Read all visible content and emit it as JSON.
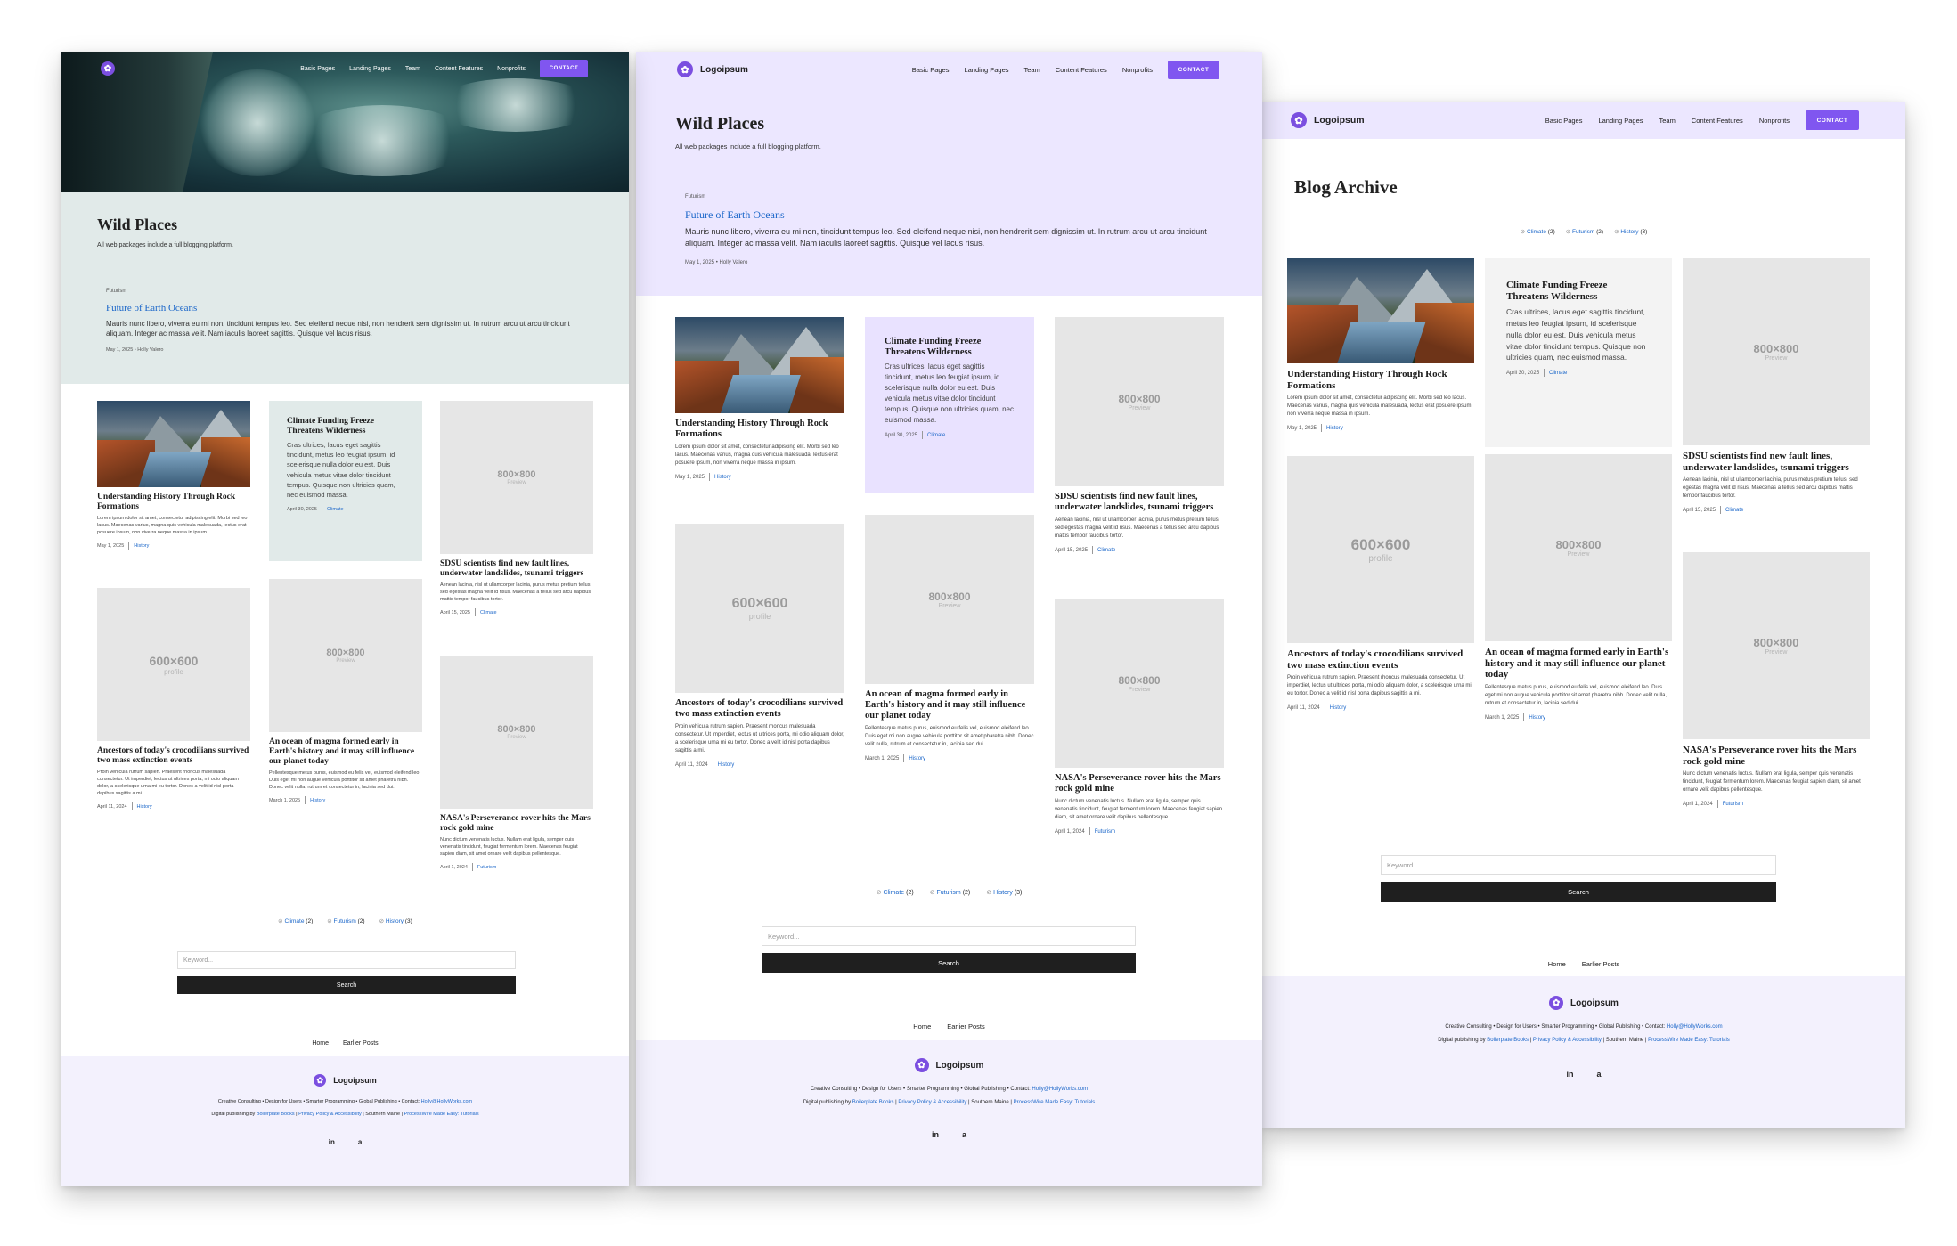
{
  "brand": {
    "name": "Logoipsum",
    "accent": "#8056f0",
    "logo_icon": "flower-icon"
  },
  "nav": {
    "items": [
      "Basic Pages",
      "Landing Pages",
      "Team",
      "Content Features",
      "Nonprofits"
    ],
    "cta": "CONTACT"
  },
  "screen1": {
    "title": "Wild Places",
    "subtitle": "All web packages include a full blogging platform.",
    "hero_bg": "#e1eae9"
  },
  "screen2": {
    "title": "Wild Places",
    "subtitle": "All web packages include a full blogging platform.",
    "hero_bg": "#ece7ff"
  },
  "screen3": {
    "title": "Blog Archive"
  },
  "featured": {
    "category": "Futurism",
    "title": "Future of Earth Oceans",
    "excerpt": "Mauris nunc libero, viverra eu mi non, tincidunt tempus leo. Sed eleifend neque nisi, non hendrerit sem dignissim ut. In rutrum arcu ut arcu tincidunt aliquam. Integer ac massa velit. Nam iaculis laoreet sagittis. Quisque vel lacus risus.",
    "meta": "May 1, 2025 • Holly Valero"
  },
  "posts": {
    "p1": {
      "title": "Understanding History Through Rock Formations",
      "excerpt": "Lorem ipsum dolor sit amet, consectetur adipiscing elit. Morbi sed leo lacus. Maecenas varius, magna quis vehicula malesuada, lectus erat posuere ipsum, non viverra neque massa in ipsum.",
      "date": "May 1, 2025",
      "tag": "History"
    },
    "p2": {
      "title": "Climate Funding Freeze Threatens Wilderness",
      "excerpt": "Cras ultrices, lacus eget sagittis tincidunt, metus leo feugiat ipsum, id scelerisque nulla dolor eu est. Duis vehicula metus vitae dolor tincidunt tempus. Quisque non ultricies quam, nec euismod massa.",
      "date": "April 30, 2025",
      "tag": "Climate"
    },
    "p3": {
      "title": "SDSU scientists find new fault lines, underwater landslides, tsunami triggers",
      "excerpt": "Aenean lacinia, nisl ut ullamcorper lacinia, purus metus pretium tellus, sed egestas magna velit id risus. Maecenas a tellus sed arcu dapibus mattis tempor faucibus tortor.",
      "date": "April 15, 2025",
      "tag": "Climate"
    },
    "p4": {
      "title": "Ancestors of today's crocodilians survived two mass extinction events",
      "excerpt": "Proin vehicula rutrum sapien. Praesent rhoncus malesuada consectetur. Ut imperdiet, lectus ut ultrices porta, mi odio aliquam dolor, a scelerisque urna mi eu tortor. Donec a velit id nisl porta dapibus sagittis a mi.",
      "date": "April 11, 2024",
      "tag": "History"
    },
    "p5": {
      "title": "An ocean of magma formed early in Earth's history and it may still influence our planet today",
      "excerpt": "Pellentesque metus purus, euismod eu felis vel, euismod eleifend leo. Duis eget mi non augue vehicula porttitor sit amet pharetra nibh. Donec velit nulla, rutrum et consectetur in, lacinia sed dui.",
      "date": "March 1, 2025",
      "tag": "History"
    },
    "p6": {
      "title": "NASA's Perseverance rover hits the Mars rock gold mine",
      "excerpt": "Nunc dictum venenatis luctus. Nullam erat ligula, semper quis venenatis tincidunt, feugiat fermentum lorem. Maecenas feugiat sapien diam, sit amet ornare velit dapibus pellentesque.",
      "date": "April 1, 2024",
      "tag": "Futurism"
    }
  },
  "placeholders": {
    "square": "600×600",
    "square_sub": "profile",
    "wide": "800×800",
    "wide_sub": "Preview"
  },
  "tags": [
    {
      "name": "Climate",
      "count": "(2)"
    },
    {
      "name": "Futurism",
      "count": "(2)"
    },
    {
      "name": "History",
      "count": "(3)"
    }
  ],
  "search": {
    "placeholder": "Keyword...",
    "button": "Search"
  },
  "pager": {
    "home": "Home",
    "earlier": "Earlier Posts"
  },
  "footer": {
    "services": "Creative Consulting • Design for Users • Smarter Programming • Global Publishing • Contact:",
    "email": "Holly@HollyWorks.com",
    "credit_prefix": "Digital publishing by",
    "link1": "Boilerplate Books",
    "link2": "Privacy Policy & Accessibility",
    "location": "Southern Maine",
    "link3": "ProcessWire Made Easy: Tutorials",
    "social": [
      "in",
      "a"
    ]
  }
}
